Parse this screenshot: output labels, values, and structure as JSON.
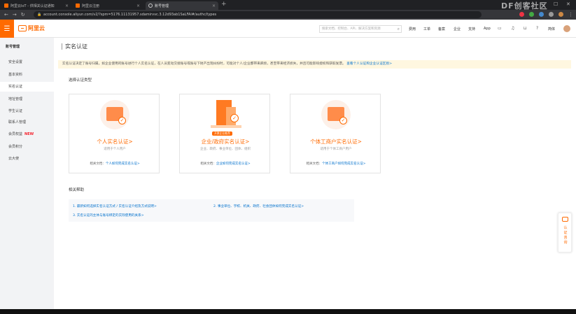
{
  "browser": {
    "tabs": [
      {
        "title": "阿里云IoT - 供相关认证通知",
        "active": false
      },
      {
        "title": "阿里云注册",
        "active": false
      },
      {
        "title": "账号管理",
        "active": true
      }
    ],
    "new_tab": "+",
    "url": "account.console.aliyun.com/v2/?spm=5176.11131957.sdamirvvc.3.12d93ab1SaLFAl#/authc/types",
    "watermark": "DF创客社区"
  },
  "header": {
    "menu_icon": "☰",
    "logo_text": "阿里云",
    "search_placeholder": "搜索文档、控制台、API、解决方案和资源",
    "nav": [
      "费用",
      "工单",
      "备案",
      "企业",
      "支持",
      "App"
    ],
    "lang": "简体"
  },
  "sidebar": {
    "title": "账号管理",
    "items": [
      {
        "label": "安全设置",
        "active": false,
        "badge": ""
      },
      {
        "label": "基本资料",
        "active": false,
        "badge": ""
      },
      {
        "label": "实名认证",
        "active": true,
        "badge": ""
      },
      {
        "label": "地址管理",
        "active": false,
        "badge": ""
      },
      {
        "label": "学生认证",
        "active": false,
        "badge": ""
      },
      {
        "label": "联系人管理",
        "active": false,
        "badge": ""
      },
      {
        "label": "会员权益",
        "active": false,
        "badge": "NEW"
      },
      {
        "label": "会员积分",
        "active": false,
        "badge": ""
      },
      {
        "label": "云大使",
        "active": false,
        "badge": ""
      }
    ]
  },
  "main": {
    "title": "实名认证",
    "notice": "实名认证决定了账号归属。如企业使用的账号进行个人实名认证，在人员变动交接账号或账号下财产出现纠纷时，可能对个人/企业都带来麻烦，甚至带来经济损失，并且可能影响授权和获取发票。",
    "notice_link": "查看个人认证和企业认证区别>",
    "choose_title": "选择认证类型",
    "cards": [
      {
        "title": "个人实名认证>",
        "subtitle": "适用于个人用户",
        "ref_label": "相关文档：",
        "ref_link": "个人如何完成实名认证>",
        "badge": ""
      },
      {
        "title": "企业/政府实名认证>",
        "subtitle": "企业、政府、事业单位、团体、组织",
        "ref_label": "相关文档：",
        "ref_link": "企业如何完成实名认证>",
        "badge": "开票企业推荐"
      },
      {
        "title": "个体工商户实名认证>",
        "subtitle": "适用于个体工商户用户",
        "ref_label": "相关文档：",
        "ref_link": "个体工商户如何完成实名认证>",
        "badge": ""
      }
    ],
    "help_title": "相关帮助",
    "help_links": [
      "1. 最新如何选择实名认证方式 / 实名认证介绍及方式说明>",
      "2. 事业单位、学校、机关、政府、社会团体如何完成实名认证>",
      "3. 实名认证的主体与账号绑定的实际使用的关系>"
    ]
  },
  "float_help": {
    "text": "认证咨询"
  }
}
